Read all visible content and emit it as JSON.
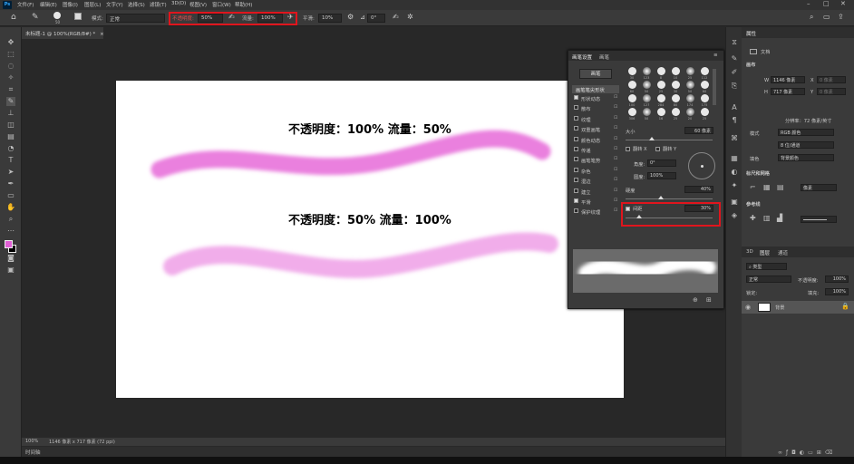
{
  "app": {
    "logo": "Ps"
  },
  "menu": [
    "文件(F)",
    "编辑(E)",
    "图像(I)",
    "图层(L)",
    "文字(Y)",
    "选择(S)",
    "滤镜(T)",
    "3D(D)",
    "视图(V)",
    "窗口(W)",
    "帮助(H)"
  ],
  "window_controls": {
    "min": "–",
    "max": "□",
    "close": "✕"
  },
  "options": {
    "brush_size": "50",
    "mode_label": "模式:",
    "mode_value": "正常",
    "opacity_label": "不透明度:",
    "opacity_value": "50%",
    "flow_label": "流量:",
    "flow_value": "100%",
    "smooth_label": "平滑:",
    "smooth_value": "10%",
    "angle_value": "0°"
  },
  "document": {
    "tab_title": "未标题-1 @ 100%(RGB/8#) *"
  },
  "canvas": {
    "caption1": "不透明度：100% 流量：50%",
    "caption2": "不透明度：50% 流量：100%",
    "stroke_color": "#e66ad8"
  },
  "status": {
    "zoom": "100%",
    "doc_info": "1146 像素 x 717 像素 (72 ppi)"
  },
  "timeline": {
    "label": "时间轴"
  },
  "colors": {
    "foreground": "#e05fd5",
    "background": "#000000"
  },
  "brush_panel": {
    "tabs": [
      "画笔设置",
      "画笔"
    ],
    "presets_button": "画笔",
    "sections": [
      {
        "label": "画笔笔尖形状",
        "checked": false,
        "header": true
      },
      {
        "label": "形状动态",
        "checked": true
      },
      {
        "label": "散布",
        "checked": false
      },
      {
        "label": "纹理",
        "checked": false
      },
      {
        "label": "双重画笔",
        "checked": false
      },
      {
        "label": "颜色动态",
        "checked": false
      },
      {
        "label": "传递",
        "checked": false
      },
      {
        "label": "画笔笔势",
        "checked": false
      },
      {
        "label": "杂色",
        "checked": false
      },
      {
        "label": "湿边",
        "checked": false
      },
      {
        "label": "建立",
        "checked": false
      },
      {
        "label": "平滑",
        "checked": true
      },
      {
        "label": "保护纹理",
        "checked": false
      }
    ],
    "tip_sizes": [
      "30",
      "123",
      "8",
      "10",
      "25",
      "112",
      "60",
      "50",
      "25",
      "30",
      "50",
      "60",
      "100",
      "127",
      "284",
      "80",
      "174",
      "175",
      "306",
      "50",
      "16",
      "25",
      "20",
      "25"
    ],
    "size_label": "大小",
    "size_value": "60 像素",
    "flip_x": "翻转 X",
    "flip_y": "翻转 Y",
    "angle_label": "角度:",
    "angle_value": "0°",
    "roundness_label": "圆度:",
    "roundness_value": "100%",
    "hardness_label": "硬度",
    "hardness_value": "40%",
    "spacing_label": "间距",
    "spacing_value": "30%"
  },
  "right_panel": {
    "props_tab": "属性",
    "doc_label": "文档",
    "canvas_section": "画布",
    "w_label": "W",
    "w_value": "1146 像素",
    "h_label": "H",
    "h_value": "717 像素",
    "x_label": "X",
    "x_placeholder": "0 像素",
    "y_label": "Y",
    "y_placeholder": "0 像素",
    "resolution": "分辨率：72 像素/英寸",
    "mode_label": "模式",
    "mode_value": "RGB 颜色",
    "depth_value": "8 位/通道",
    "fill_label": "填色",
    "fill_value": "背景颜色",
    "rulers_section": "标尺和网格",
    "unit_value": "像素",
    "guides_section": "参考线",
    "layers_tabs": [
      "3D",
      "图层",
      "通道"
    ],
    "kind_label": "类型",
    "blend_mode": "正常",
    "opacity_label": "不透明度:",
    "opacity_value": "100%",
    "lock_label": "锁定:",
    "fill_lbl": "填充:",
    "fill_pct": "100%",
    "layer_name": "背景"
  }
}
